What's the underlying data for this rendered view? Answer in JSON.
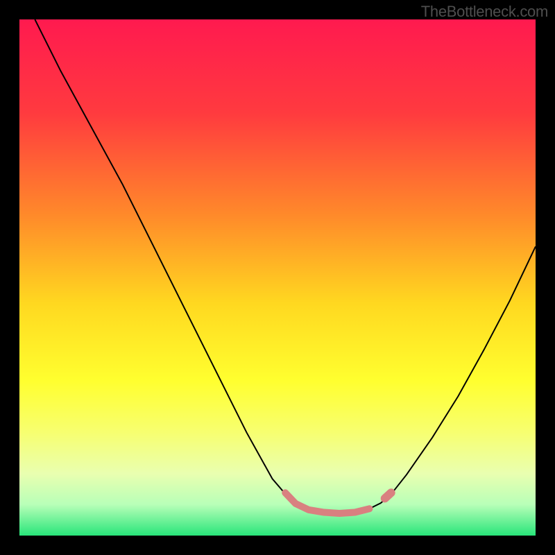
{
  "attribution": "TheBottleneck.com",
  "chart_data": {
    "type": "line",
    "title": "",
    "xlabel": "",
    "ylabel": "",
    "xlim": [
      0,
      1
    ],
    "ylim": [
      0,
      1
    ],
    "background_gradient": {
      "stops": [
        {
          "offset": 0.0,
          "color": "#ff1a4f"
        },
        {
          "offset": 0.18,
          "color": "#ff3a3f"
        },
        {
          "offset": 0.38,
          "color": "#ff8a2a"
        },
        {
          "offset": 0.55,
          "color": "#ffd820"
        },
        {
          "offset": 0.7,
          "color": "#ffff2f"
        },
        {
          "offset": 0.8,
          "color": "#f7ff70"
        },
        {
          "offset": 0.88,
          "color": "#e9ffb0"
        },
        {
          "offset": 0.94,
          "color": "#b8ffb8"
        },
        {
          "offset": 1.0,
          "color": "#28e57a"
        }
      ]
    },
    "series": [
      {
        "name": "curve",
        "color": "#000000",
        "width": 2,
        "points": [
          {
            "x": 0.03,
            "y": 1.0
          },
          {
            "x": 0.08,
            "y": 0.9
          },
          {
            "x": 0.14,
            "y": 0.79
          },
          {
            "x": 0.2,
            "y": 0.68
          },
          {
            "x": 0.26,
            "y": 0.56
          },
          {
            "x": 0.32,
            "y": 0.44
          },
          {
            "x": 0.38,
            "y": 0.32
          },
          {
            "x": 0.44,
            "y": 0.2
          },
          {
            "x": 0.49,
            "y": 0.11
          },
          {
            "x": 0.52,
            "y": 0.075
          },
          {
            "x": 0.54,
            "y": 0.06
          },
          {
            "x": 0.56,
            "y": 0.05
          },
          {
            "x": 0.59,
            "y": 0.045
          },
          {
            "x": 0.62,
            "y": 0.043
          },
          {
            "x": 0.65,
            "y": 0.045
          },
          {
            "x": 0.68,
            "y": 0.053
          },
          {
            "x": 0.7,
            "y": 0.063
          },
          {
            "x": 0.72,
            "y": 0.08
          },
          {
            "x": 0.75,
            "y": 0.118
          },
          {
            "x": 0.8,
            "y": 0.19
          },
          {
            "x": 0.85,
            "y": 0.27
          },
          {
            "x": 0.9,
            "y": 0.36
          },
          {
            "x": 0.95,
            "y": 0.455
          },
          {
            "x": 1.0,
            "y": 0.56
          }
        ]
      },
      {
        "name": "highlight",
        "color": "#d98080",
        "width": 10,
        "linecap": "round",
        "points": [
          {
            "x": 0.515,
            "y": 0.083
          },
          {
            "x": 0.535,
            "y": 0.062
          },
          {
            "x": 0.56,
            "y": 0.05
          },
          {
            "x": 0.59,
            "y": 0.045
          },
          {
            "x": 0.62,
            "y": 0.043
          },
          {
            "x": 0.65,
            "y": 0.045
          },
          {
            "x": 0.678,
            "y": 0.052
          }
        ]
      },
      {
        "name": "highlight-dot",
        "color": "#d98080",
        "width": 12,
        "linecap": "round",
        "points": [
          {
            "x": 0.708,
            "y": 0.072
          },
          {
            "x": 0.72,
            "y": 0.083
          }
        ]
      }
    ]
  }
}
